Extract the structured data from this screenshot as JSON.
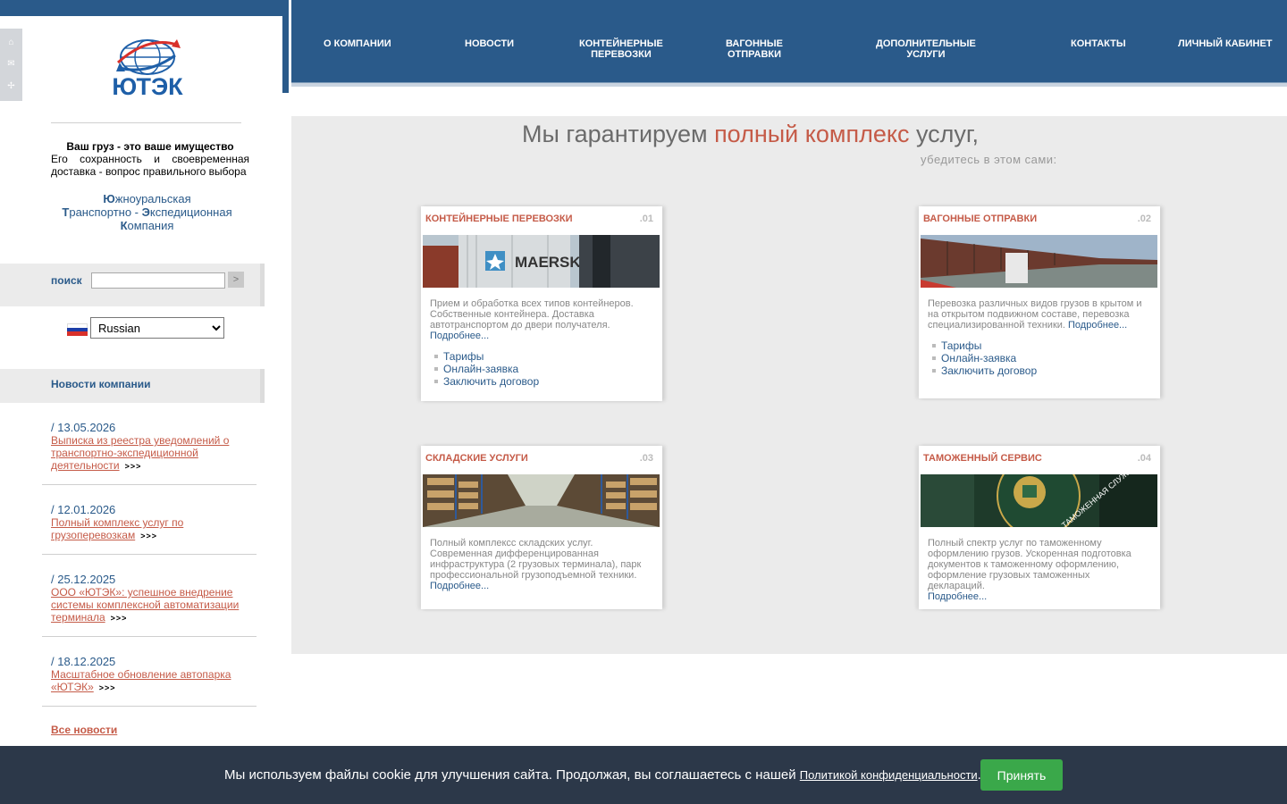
{
  "quick_icons": [
    "home-icon",
    "mail-icon",
    "sitemap-icon"
  ],
  "logo": {
    "text": "ЮТЭК"
  },
  "slogan": {
    "title": "Ваш груз - это ваше имущество",
    "text": "Его сохранность и своевременная доставка - вопрос правильного выбора"
  },
  "company": {
    "line1_initial": "Ю",
    "line1_rest": "жноуральская",
    "line2_initial": "Т",
    "line2_rest": "ранспортно - ",
    "line2_initial2": "Э",
    "line2_rest2": "кспедиционная",
    "line3_initial": "К",
    "line3_rest": "омпания"
  },
  "search": {
    "label": "поиск",
    "button": ">"
  },
  "language": {
    "selected": "Russian"
  },
  "news": {
    "header": "Новости компании",
    "items": [
      {
        "date": "/ 13.05.2026",
        "title": "Выписка из реестра уведомлений о транспортно-экспедиционной деятельности",
        "more": ">>>"
      },
      {
        "date": "/ 12.01.2026",
        "title": "Полный комплекс услуг по грузоперевозкам",
        "more": ">>>"
      },
      {
        "date": "/ 25.12.2025",
        "title": "ООО «ЮТЭК»: успешное внедрение системы комплексной автоматизации терминала",
        "more": ">>>"
      },
      {
        "date": "/ 18.12.2025",
        "title": "Масштабное обновление автопарка «ЮТЭК»",
        "more": ">>>"
      }
    ],
    "all": "Все новости"
  },
  "nav": {
    "about": "О КОМПАНИИ",
    "news": "НОВОСТИ",
    "container_1": "КОНТЕЙНЕРНЫЕ",
    "container_2": "ПЕРЕВОЗКИ",
    "wagon_1": "ВАГОННЫЕ",
    "wagon_2": "ОТПРАВКИ",
    "extra_1": "ДОПОЛНИТЕЛЬНЫЕ",
    "extra_2": "УСЛУГИ",
    "contacts": "КОНТАКТЫ",
    "cabinet": "ЛИЧНЫЙ КАБИНЕТ"
  },
  "headline": {
    "part1": "Мы гарантируем ",
    "accent": "полный комплекс",
    "part2": " услуг,",
    "sub": "убедитесь в этом сами:"
  },
  "cards": [
    {
      "title": "КОНТЕЙНЕРНЫЕ ПЕРЕВОЗКИ",
      "num": ".01",
      "desc": "Прием и обработка всех типов контейнеров. Собственные контейнера. Доставка автотранспортом до двери получателя.",
      "more": "Подробнее...",
      "links": [
        "Тарифы",
        "Онлайн-заявка",
        "Заключить договор"
      ],
      "image_text": "MAERSK SEALAND"
    },
    {
      "title": "ВАГОННЫЕ ОТПРАВКИ",
      "num": ".02",
      "desc": "Перевозка различных видов грузов в крытом и на открытом подвижном составе, перевозка специализированной техники.",
      "more": "Подробнее...",
      "links": [
        "Тарифы",
        "Онлайн-заявка",
        "Заключить договор"
      ]
    },
    {
      "title": "СКЛАДСКИЕ УСЛУГИ",
      "num": ".03",
      "desc": "Полный комплексс складских услуг. Современная дифференцированная инфраструктура (2 грузовых терминала), парк профессиональной грузоподъемной техники.",
      "more": "Подробнее..."
    },
    {
      "title": "ТАМОЖЕННЫЙ СЕРВИС",
      "num": ".04",
      "desc": "Полный спектр услуг по таможенному оформлению грузов. Ускоренная подготовка документов к таможенному оформлению, оформление грузовых таможенных деклараций.",
      "more": "Подробнее...",
      "image_text": "ТАМОЖЕННАЯ СЛУЖБА"
    }
  ],
  "cookie": {
    "text": "Мы используем файлы cookie для улучшения сайта. Продолжая, вы соглашаетесь с нашей ",
    "link": "Политикой конфиденциальности",
    "end": ".",
    "accept": "Принять"
  }
}
